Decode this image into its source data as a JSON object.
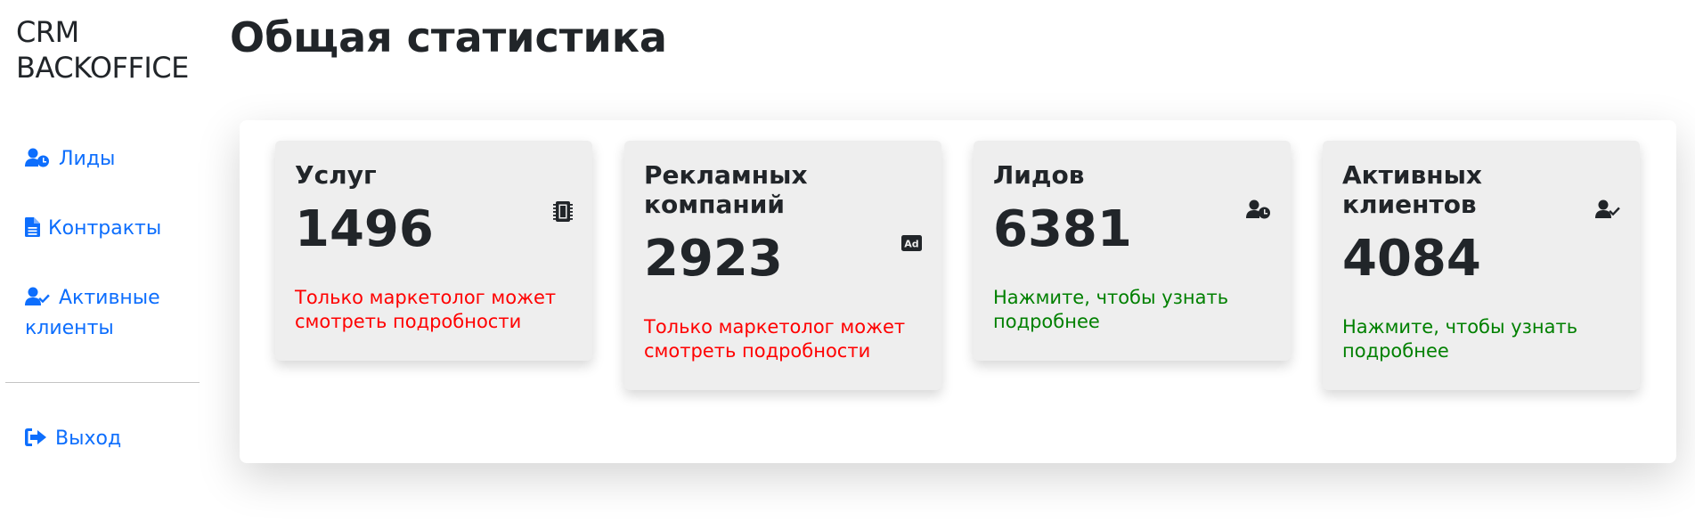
{
  "sidebar": {
    "brand_line1": "CRM",
    "brand_line2": "BACKOFFICE",
    "items": [
      {
        "label": "Лиды",
        "icon": "user-clock-icon"
      },
      {
        "label": "Контракты",
        "icon": "file-icon"
      },
      {
        "label": "Активные клиенты",
        "icon": "user-check-icon"
      }
    ],
    "logout": {
      "label": "Выход",
      "icon": "sign-out-icon"
    }
  },
  "main": {
    "title": "Общая статистика",
    "cards": [
      {
        "title": "Услуг",
        "value": "1496",
        "note": "Только маркетолог может смотреть подробности",
        "icon": "microchip-icon"
      },
      {
        "title": "Рекламных компаний",
        "value": "2923",
        "note": "Только маркетолог может смотреть подробности",
        "icon": "ad-icon"
      },
      {
        "title": "Лидов",
        "value": "6381",
        "note": "Нажмите, чтобы узнать подробнее",
        "icon": "user-clock-icon"
      },
      {
        "title": "Активных клиентов",
        "value": "4084",
        "note": "Нажмите, чтобы узнать подробнее",
        "icon": "user-check-icon"
      }
    ]
  },
  "colors": {
    "link": "#0d6efd",
    "restricted_note": "#ff0000",
    "action_note": "#008000",
    "card_bg": "#eeeeee"
  }
}
